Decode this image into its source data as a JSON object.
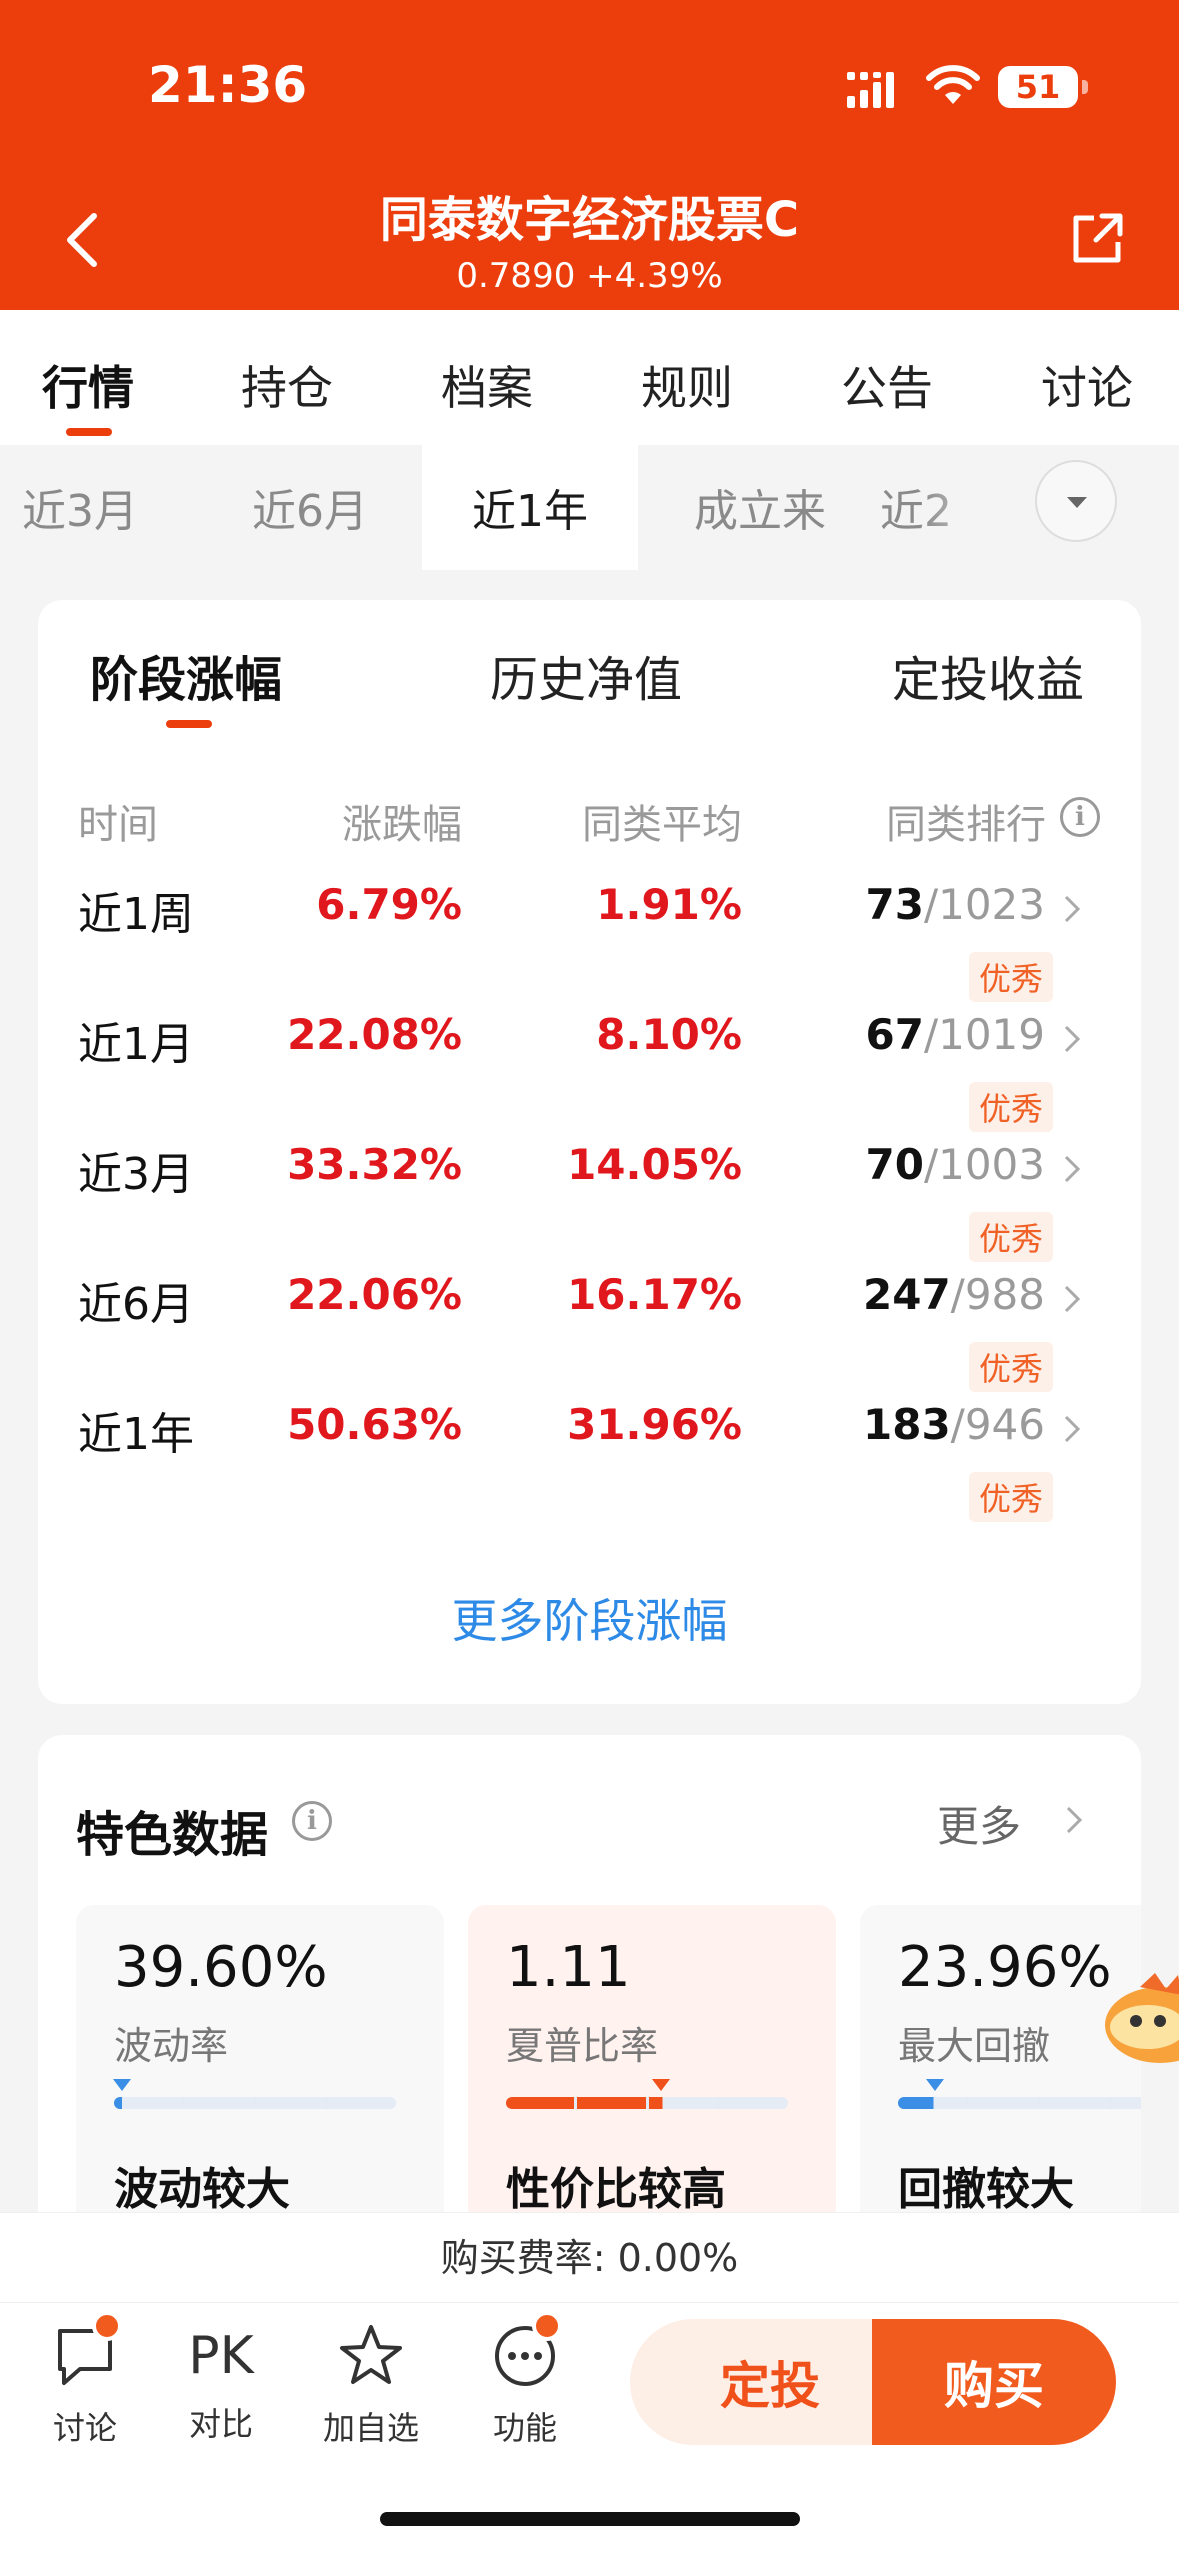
{
  "status_bar": {
    "time": "21:36",
    "battery": "51"
  },
  "header": {
    "title": "同泰数字经济股票C",
    "subtitle": "0.7890 +4.39%"
  },
  "tabs": [
    "行情",
    "持仓",
    "档案",
    "规则",
    "公告",
    "讨论"
  ],
  "period_tabs": [
    "近3月",
    "近6月",
    "近1年",
    "成立来",
    "近2"
  ],
  "performance": {
    "subtabs": [
      "阶段涨幅",
      "历史净值",
      "定投收益"
    ],
    "headers": {
      "time": "时间",
      "change": "涨跌幅",
      "peer_avg": "同类平均",
      "rank": "同类排行"
    },
    "rows": [
      {
        "label": "近1周",
        "change": "6.79%",
        "avg": "1.91%",
        "rank": "73",
        "total": "/1023",
        "badge": "优秀"
      },
      {
        "label": "近1月",
        "change": "22.08%",
        "avg": "8.10%",
        "rank": "67",
        "total": "/1019",
        "badge": "优秀"
      },
      {
        "label": "近3月",
        "change": "33.32%",
        "avg": "14.05%",
        "rank": "70",
        "total": "/1003",
        "badge": "优秀"
      },
      {
        "label": "近6月",
        "change": "22.06%",
        "avg": "16.17%",
        "rank": "247",
        "total": "/988",
        "badge": "优秀"
      },
      {
        "label": "近1年",
        "change": "50.63%",
        "avg": "31.96%",
        "rank": "183",
        "total": "/946",
        "badge": "优秀"
      }
    ],
    "more_link": "更多阶段涨幅"
  },
  "features": {
    "title": "特色数据",
    "more": "更多",
    "items": [
      {
        "value": "39.60%",
        "label": "波动率",
        "note": "波动较大",
        "level": 0.03,
        "color": "#3a8ee6"
      },
      {
        "value": "1.11",
        "label": "夏普比率",
        "note": "性价比较高",
        "level": 0.55,
        "color": "#f0501a"
      },
      {
        "value": "23.96%",
        "label": "最大回撤",
        "note": "回撤较大",
        "level": 0.13,
        "color": "#3a8ee6"
      }
    ]
  },
  "fee_text": "购买费率: 0.00%",
  "bottom_bar": {
    "discuss": "讨论",
    "pk_icon": "PK",
    "compare": "对比",
    "watch": "加自选",
    "function": "功能",
    "sip": "定投",
    "buy": "购买"
  }
}
